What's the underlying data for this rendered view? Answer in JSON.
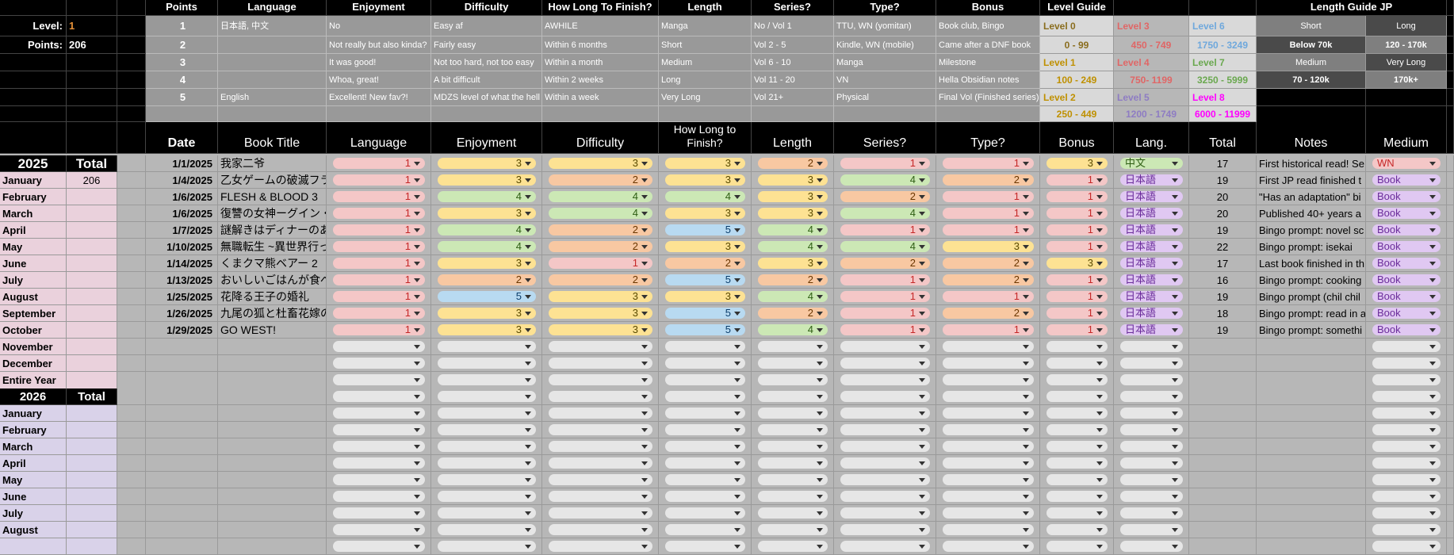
{
  "summary": {
    "level_label": "Level:",
    "level_value": "1",
    "points_label": "Points:",
    "points_value": "206"
  },
  "points_table": {
    "headers": [
      "Points",
      "Language",
      "Enjoyment",
      "Difficulty",
      "How Long To Finish?",
      "Length",
      "Series?",
      "Type?",
      "Bonus"
    ],
    "rows": [
      [
        "1",
        "日本語, 中文",
        "No",
        "Easy af",
        "AWHILE",
        "Manga",
        "No / Vol 1",
        "TTU, WN (yomitan)",
        "Book club, Bingo"
      ],
      [
        "2",
        "",
        "Not really but also kinda?",
        "Fairly easy",
        "Within 6 months",
        "Short",
        "Vol 2 - 5",
        "Kindle, WN (mobile)",
        "Came after a DNF book"
      ],
      [
        "3",
        "",
        "It was good!",
        "Not too hard, not too easy",
        "Within a month",
        "Medium",
        "Vol 6 - 10",
        "Manga",
        "Milestone"
      ],
      [
        "4",
        "",
        "Whoa, great!",
        "A bit difficult",
        "Within 2 weeks",
        "Long",
        "Vol 11 - 20",
        "VN",
        "Hella Obsidian notes"
      ],
      [
        "5",
        "English",
        "Excellent! New fav?!",
        "MDZS level of what the hell",
        "Within a week",
        "Very Long",
        "Vol 21+",
        "Physical",
        "Final Vol (Finished series)"
      ]
    ]
  },
  "level_guide": {
    "title": "Level Guide",
    "levels": [
      {
        "name": "Level 0",
        "range": "0 - 99",
        "color": "#8a6d1e"
      },
      {
        "name": "Level 3",
        "range": "450 - 749",
        "color": "#e06666"
      },
      {
        "name": "Level 6",
        "range": "1750 - 3249",
        "color": "#6fa8dc"
      },
      {
        "name": "Level 1",
        "range": "100 - 249",
        "color": "#bf9000"
      },
      {
        "name": "Level 4",
        "range": "750- 1199",
        "color": "#e06666"
      },
      {
        "name": "Level 7",
        "range": "3250 - 5999",
        "color": "#6aa84f"
      },
      {
        "name": "Level 2",
        "range": "250 - 449",
        "color": "#bf9000"
      },
      {
        "name": "Level 5",
        "range": "1200 - 1749",
        "color": "#8e7cc3"
      },
      {
        "name": "Level 8",
        "range": "6000 - 11999",
        "color": "#ff00ff"
      }
    ]
  },
  "length_guide": {
    "title": "Length Guide JP",
    "rows": [
      [
        "Short",
        "Long"
      ],
      [
        "Below 70k",
        "120 - 170k"
      ],
      [
        "Medium",
        "Very Long"
      ],
      [
        "70 - 120k",
        "170k+"
      ]
    ]
  },
  "log_headers": [
    "Date",
    "Book Title",
    "Language",
    "Enjoyment",
    "Difficulty",
    "How Long to Finish?",
    "Length",
    "Series?",
    "Type?",
    "Bonus",
    "Lang.",
    "Total",
    "Notes",
    "Medium"
  ],
  "year_2025": {
    "year": "2025",
    "total_label": "Total",
    "months": [
      "January",
      "February",
      "March",
      "April",
      "May",
      "June",
      "July",
      "August",
      "September",
      "October",
      "November",
      "December",
      "Entire Year"
    ],
    "jan_total": "206"
  },
  "year_2026": {
    "year": "2026",
    "total_label": "Total",
    "months": [
      "January",
      "February",
      "March",
      "April",
      "May",
      "June",
      "July",
      "August"
    ]
  },
  "entries": [
    {
      "date": "1/1/2025",
      "title": "我家二爷",
      "vals": [
        "1",
        "3",
        "3",
        "3",
        "2",
        "1",
        "1",
        "3"
      ],
      "lang": "中文",
      "total": "17",
      "notes": "First historical read! Se",
      "medium": "WN"
    },
    {
      "date": "1/4/2025",
      "title": "乙女ゲームの破滅フラ",
      "vals": [
        "1",
        "3",
        "2",
        "3",
        "3",
        "4",
        "2",
        "1"
      ],
      "lang": "日本語",
      "total": "19",
      "notes": "First JP read finished t",
      "medium": "Book"
    },
    {
      "date": "1/6/2025",
      "title": "FLESH & BLOOD 3",
      "vals": [
        "1",
        "4",
        "4",
        "4",
        "3",
        "2",
        "1",
        "1"
      ],
      "lang": "日本語",
      "total": "20",
      "notes": "\"Has an adaptation\" bi",
      "medium": "Book"
    },
    {
      "date": "1/6/2025",
      "title": "復讐の女神ーグイン・",
      "vals": [
        "1",
        "3",
        "4",
        "3",
        "3",
        "4",
        "1",
        "1"
      ],
      "lang": "日本語",
      "total": "20",
      "notes": "Published 40+ years a",
      "medium": "Book"
    },
    {
      "date": "1/7/2025",
      "title": "謎解きはディナーのあ",
      "vals": [
        "1",
        "4",
        "2",
        "5",
        "4",
        "1",
        "1",
        "1"
      ],
      "lang": "日本語",
      "total": "19",
      "notes": "Bingo prompt: novel sc",
      "medium": "Book"
    },
    {
      "date": "1/10/2025",
      "title": "無職転生 ~異世界行っ",
      "vals": [
        "1",
        "4",
        "2",
        "3",
        "4",
        "4",
        "3",
        "1"
      ],
      "lang": "日本語",
      "total": "22",
      "notes": "Bingo prompt: isekai",
      "medium": "Book"
    },
    {
      "date": "1/14/2025",
      "title": "くまクマ熊ベアー 2",
      "vals": [
        "1",
        "3",
        "1",
        "2",
        "3",
        "2",
        "2",
        "3"
      ],
      "lang": "日本語",
      "total": "17",
      "notes": "Last book finished in th",
      "medium": "Book"
    },
    {
      "date": "1/13/2025",
      "title": "おいしいごはんが食べ",
      "vals": [
        "1",
        "2",
        "2",
        "5",
        "2",
        "1",
        "2",
        "1"
      ],
      "lang": "日本語",
      "total": "16",
      "notes": "Bingo prompt: cooking",
      "medium": "Book"
    },
    {
      "date": "1/25/2025",
      "title": "花降る王子の婚礼",
      "vals": [
        "1",
        "5",
        "3",
        "3",
        "4",
        "1",
        "1",
        "1"
      ],
      "lang": "日本語",
      "total": "19",
      "notes": "Bingo prompt (chil chil",
      "medium": "Book"
    },
    {
      "date": "1/26/2025",
      "title": "九尾の狐と杜畜花嫁の",
      "vals": [
        "1",
        "3",
        "3",
        "5",
        "2",
        "1",
        "2",
        "1"
      ],
      "lang": "日本語",
      "total": "18",
      "notes": "Bingo prompt: read in a",
      "medium": "Book"
    },
    {
      "date": "1/29/2025",
      "title": "GO WEST!",
      "vals": [
        "1",
        "3",
        "3",
        "5",
        "4",
        "1",
        "1",
        "1"
      ],
      "lang": "日本語",
      "total": "19",
      "notes": "Bingo prompt: somethi",
      "medium": "Book"
    }
  ]
}
